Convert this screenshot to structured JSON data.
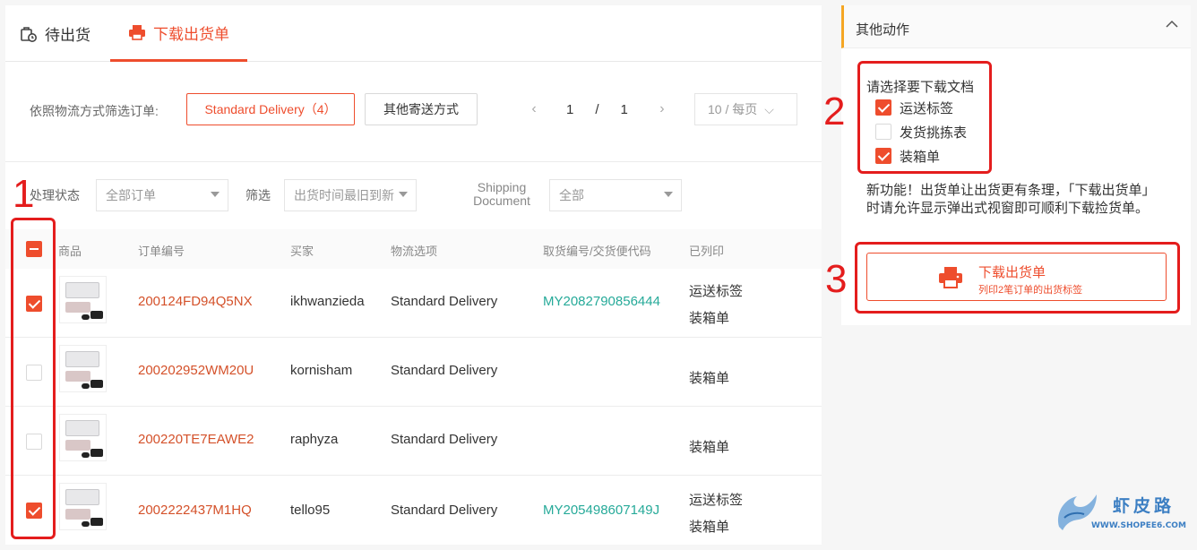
{
  "tabs": {
    "pending": "待出货",
    "download": "下载出货单"
  },
  "filter": {
    "label": "依照物流方式筛选订单:",
    "standard": "Standard Delivery（4）",
    "other": "其他寄送方式"
  },
  "pager": {
    "current": "1",
    "separator": "/",
    "total": "1",
    "per_page": "10 / 每页"
  },
  "status": {
    "label": "处理状态",
    "value": "全部订单",
    "filter_label": "筛选",
    "filter_value": "出货时间最旧到新",
    "doc_label_line1": "Shipping",
    "doc_label_line2": "Document",
    "doc_value": "全部"
  },
  "table": {
    "headers": {
      "product": "商品",
      "order_no": "订单编号",
      "buyer": "买家",
      "logistics": "物流选项",
      "tracking": "取货编号/交货便代码",
      "printed": "已列印"
    },
    "rows": [
      {
        "order": "200124FD94Q5NX",
        "buyer": "ikhwanzieda",
        "logistics": "Standard Delivery",
        "tracking": "MY2082790856444",
        "printed1": "运送标签",
        "printed2": "装箱单",
        "checked": true
      },
      {
        "order": "200202952WM20U",
        "buyer": "kornisham",
        "logistics": "Standard Delivery",
        "tracking": "",
        "printed1": "",
        "printed2": "装箱单",
        "checked": false
      },
      {
        "order": "200220TE7EAWE2",
        "buyer": "raphyza",
        "logistics": "Standard Delivery",
        "tracking": "",
        "printed1": "",
        "printed2": "装箱单",
        "checked": false
      },
      {
        "order": "2002222437M1HQ",
        "buyer": "tello95",
        "logistics": "Standard Delivery",
        "tracking": "MY205498607149J",
        "printed1": "运送标签",
        "printed2": "装箱单",
        "checked": true
      }
    ]
  },
  "side": {
    "title": "其他动作",
    "prompt": "请选择要下载文档",
    "options": [
      {
        "label": "运送标签",
        "checked": true
      },
      {
        "label": "发货挑拣表",
        "checked": false
      },
      {
        "label": "装箱单",
        "checked": true
      }
    ],
    "notice": "新功能！出货单让出货更有条理，「下载出货单」时请允许显示弹出式视窗即可顺利下载捡货单。",
    "download_title": "下载出货单",
    "download_sub": "列印2笔订单的出货标签"
  },
  "annotations": [
    "1",
    "2",
    "3"
  ],
  "watermark": {
    "text": "虾皮路",
    "url": "WWW.SHOPEE6.COM"
  },
  "colors": {
    "accent": "#ee4d2d",
    "tracking": "#26aa99",
    "annotation": "#e41d1d",
    "side_bar": "#f5a623"
  }
}
